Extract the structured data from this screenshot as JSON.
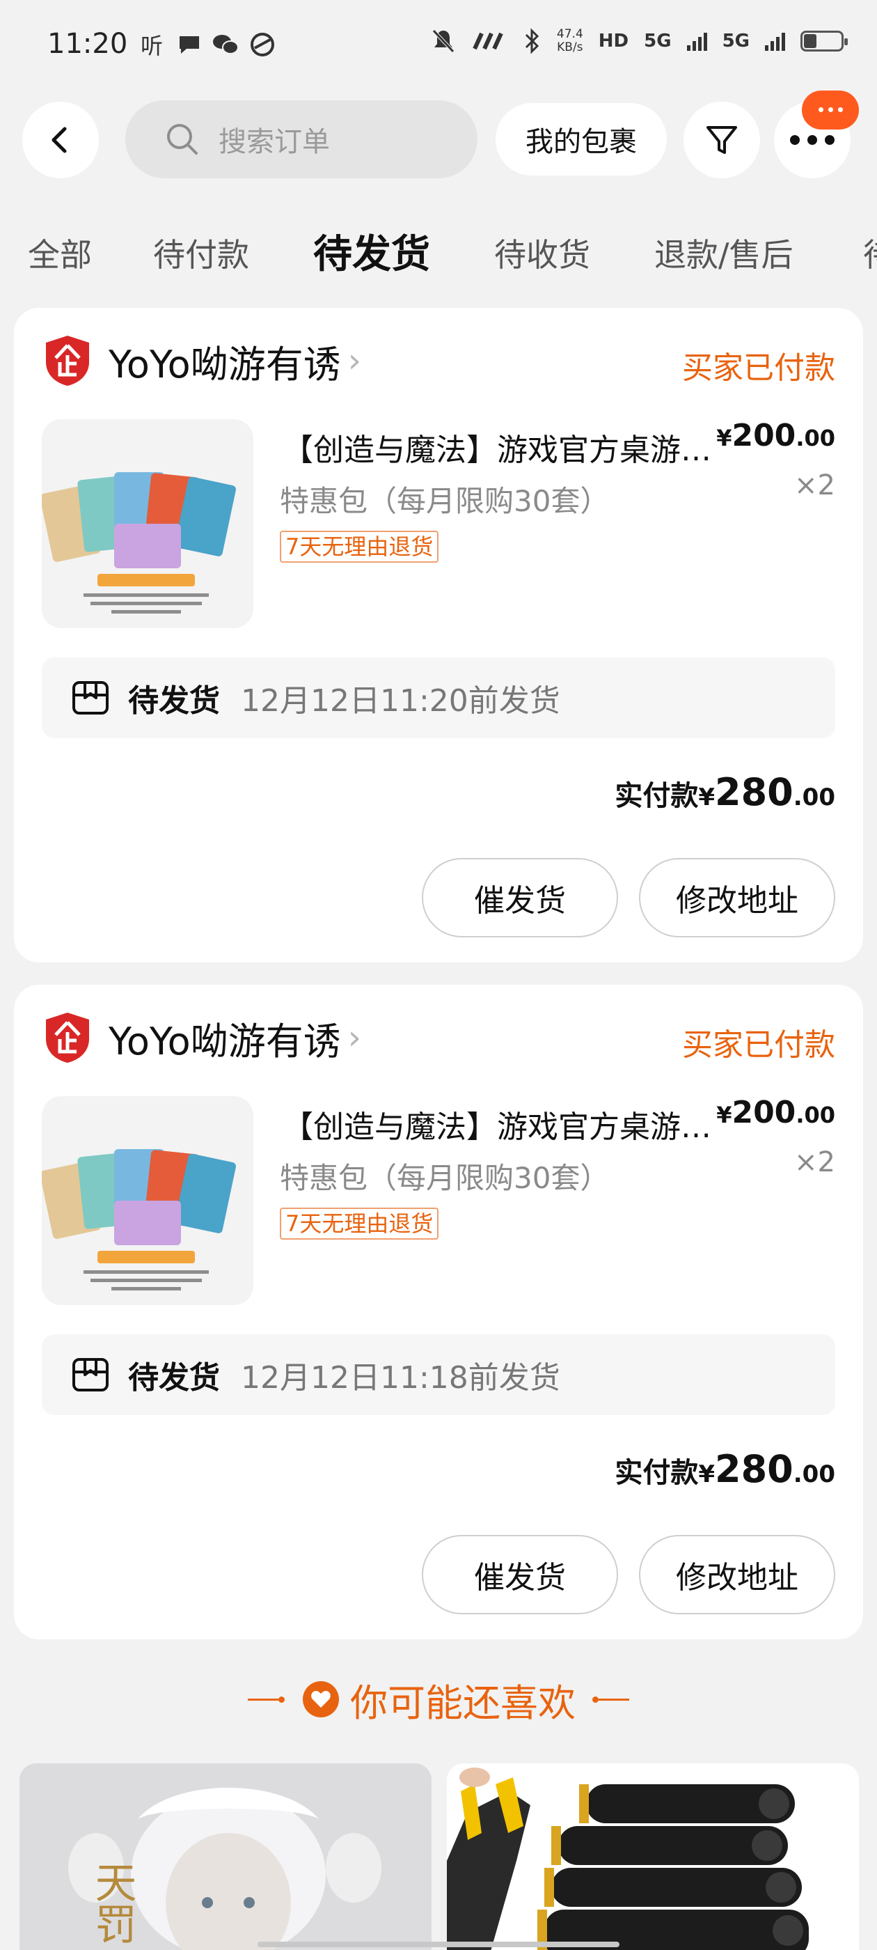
{
  "status_bar": {
    "time": "11:20",
    "left_icons": [
      "hearing-icon",
      "message-icon",
      "wechat-icon",
      "app-icon"
    ],
    "speed_value": "47.4",
    "speed_unit": "KB/s",
    "hd_label": "HD",
    "net1": "5G",
    "net2": "5G",
    "battery_level": 0.35
  },
  "nav": {
    "search_placeholder": "搜索订单",
    "package_label": "我的包裹"
  },
  "tabs": [
    {
      "label": "全部"
    },
    {
      "label": "待付款"
    },
    {
      "label": "待发货",
      "active": true
    },
    {
      "label": "待收货"
    },
    {
      "label": "退款/售后"
    },
    {
      "label": "待"
    }
  ],
  "orders": [
    {
      "shop_name": "YoYo呦游有诱",
      "status": "买家已付款",
      "product_title": "【创造与魔法】游戏官方桌游卡牌",
      "spec": "特惠包（每月限购30套）",
      "tag": "7天无理由退货",
      "price_currency": "¥",
      "price_int": "200",
      "price_dec": ".00",
      "qty": "×2",
      "ship_label": "待发货",
      "ship_time": "12月12日11:20前发货",
      "paid_label": "实付款",
      "paid_currency": "¥",
      "paid_int": "280",
      "paid_dec": ".00",
      "btn_urge": "催发货",
      "btn_addr": "修改地址"
    },
    {
      "shop_name": "YoYo呦游有诱",
      "status": "买家已付款",
      "product_title": "【创造与魔法】游戏官方桌游卡牌",
      "spec": "特惠包（每月限购30套）",
      "tag": "7天无理由退货",
      "price_currency": "¥",
      "price_int": "200",
      "price_dec": ".00",
      "qty": "×2",
      "ship_label": "待发货",
      "ship_time": "12月12日11:18前发货",
      "paid_label": "实付款",
      "paid_currency": "¥",
      "paid_int": "280",
      "paid_dec": ".00",
      "btn_urge": "催发货",
      "btn_addr": "修改地址"
    }
  ],
  "recommend": {
    "title": "你可能还喜欢",
    "left_logo_text": "天罚"
  },
  "colors": {
    "accent": "#e8630f",
    "badge": "#ff5a1e",
    "shop_logo": "#d92727"
  }
}
